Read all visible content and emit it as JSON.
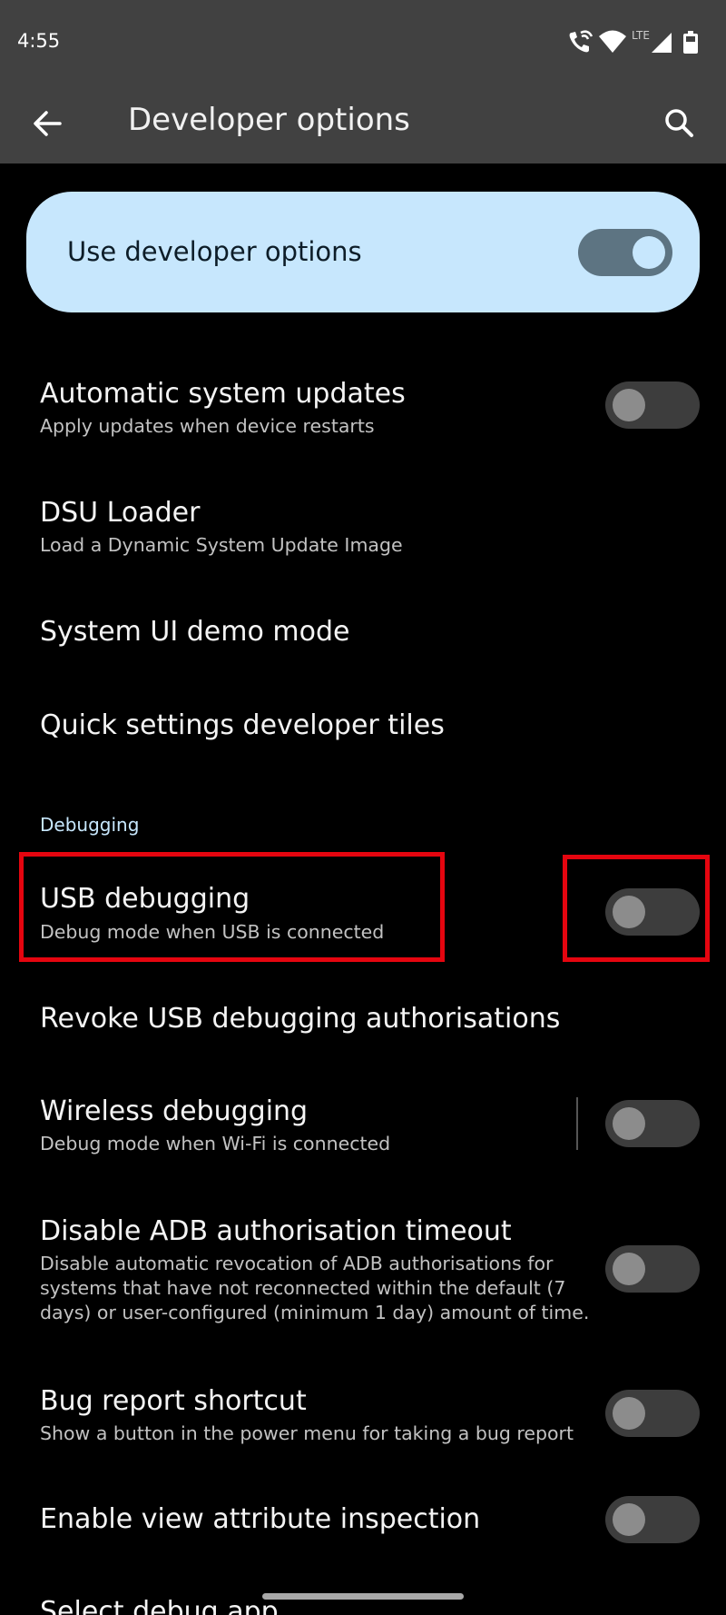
{
  "status_bar": {
    "time": "4:55",
    "icons": [
      "wifi-calling-icon",
      "wifi-icon",
      "lte-icon",
      "signal-icon",
      "battery-icon"
    ],
    "network_label": "LTE"
  },
  "app_bar": {
    "title": "Developer options",
    "back_icon": "arrow-left-icon",
    "search_icon": "search-icon"
  },
  "master": {
    "label": "Use developer options",
    "enabled": true
  },
  "rows": [
    {
      "title": "Automatic system updates",
      "summary": "Apply updates when device restarts",
      "toggle": false
    },
    {
      "title": "DSU Loader",
      "summary": "Load a Dynamic System Update Image"
    },
    {
      "title": "System UI demo mode"
    },
    {
      "title": "Quick settings developer tiles"
    }
  ],
  "debugging": {
    "header": "Debugging",
    "usb": {
      "title": "USB debugging",
      "summary": "Debug mode when USB is connected",
      "toggle": false
    },
    "revoke": {
      "title": "Revoke USB debugging authorisations"
    },
    "wireless": {
      "title": "Wireless debugging",
      "summary": "Debug mode when Wi-Fi is connected",
      "toggle": false
    },
    "adb_timeout": {
      "title": "Disable ADB authorisation timeout",
      "summary_lines": [
        "Disable automatic revocation of ADB authorisations for",
        "systems that have not reconnected within the default (7",
        "days) or user-configured (minimum 1 day) amount of time."
      ],
      "toggle": false
    },
    "bug_report": {
      "title": "Bug report shortcut",
      "summary": "Show a button in the power menu for taking a bug report",
      "toggle": false
    },
    "view_attr": {
      "title": "Enable view attribute inspection",
      "toggle": false
    },
    "debug_app": {
      "title": "Select debug app"
    }
  },
  "colors": {
    "app_bar": "#414141",
    "card": "#c7e7fd",
    "highlight": "#e5050f",
    "accent_text": "#c7e7fd"
  }
}
